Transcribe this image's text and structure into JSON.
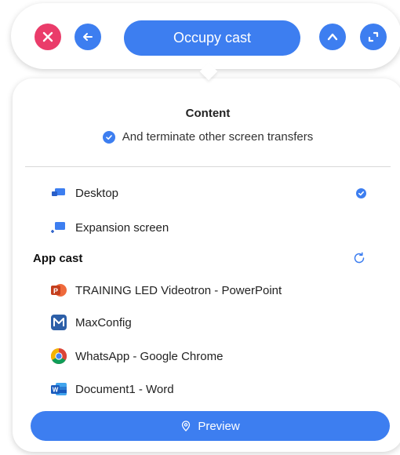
{
  "toolbar": {
    "occupy_label": "Occupy cast",
    "icons": [
      "close-icon",
      "back-arrow-icon",
      "chevron-up-icon",
      "expand-icon"
    ]
  },
  "panel": {
    "content_title": "Content",
    "terminate_label": "And terminate other screen transfers",
    "terminate_checked": true,
    "sources": [
      {
        "label": "Desktop",
        "icon": "desktop-icon",
        "selected": true
      },
      {
        "label": "Expansion screen",
        "icon": "expansion-screen-icon",
        "selected": false
      }
    ],
    "app_cast_title": "App cast",
    "apps": [
      {
        "label": "TRAINING LED Videotron - PowerPoint",
        "icon": "powerpoint-icon"
      },
      {
        "label": "MaxConfig",
        "icon": "maxconfig-icon"
      },
      {
        "label": "WhatsApp - Google Chrome",
        "icon": "chrome-icon"
      },
      {
        "label": "Document1 - Word",
        "icon": "word-icon"
      }
    ],
    "preview_label": "Preview"
  },
  "colors": {
    "accent": "#3d7ef0",
    "close": "#ea3c6a"
  }
}
